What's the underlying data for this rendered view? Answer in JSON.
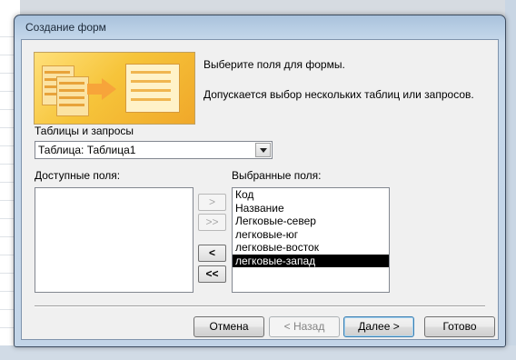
{
  "dialog": {
    "title": "Создание форм",
    "description_line1": "Выберите поля для формы.",
    "description_line2": "Допускается выбор нескольких таблиц или запросов."
  },
  "tables": {
    "label": "Таблицы и запросы",
    "selected": "Таблица: Таблица1"
  },
  "available_fields": {
    "label": "Доступные поля:",
    "items": []
  },
  "selected_fields": {
    "label": "Выбранные поля:",
    "items": [
      "Код",
      "Название",
      "Легковые-север",
      "легковые-юг",
      "легковые-восток",
      "легковые-запад"
    ],
    "selected_index": 5
  },
  "move_buttons": {
    "add_one": ">",
    "add_all": ">>",
    "remove_one": "<",
    "remove_all": "<<"
  },
  "footer": {
    "cancel": "Отмена",
    "back": "< Назад",
    "next": "Далее >",
    "finish": "Готово"
  }
}
